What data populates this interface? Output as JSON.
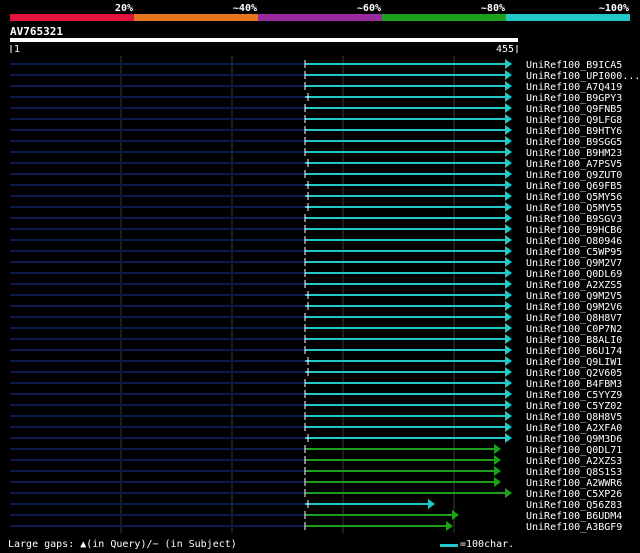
{
  "query": {
    "name": "AV765321",
    "start": "1",
    "end": "455"
  },
  "legend": {
    "labels": [
      "20%",
      "~40%",
      "~60%",
      "~80%",
      "~100%"
    ],
    "colors": [
      "#e0143c",
      "#e8761e",
      "#9a2aa0",
      "#1ea01e",
      "#20c8c8"
    ]
  },
  "colors": {
    "cyan": "#20c8c8",
    "green": "#1ea01e",
    "query_line": "#ffffff",
    "track": "#0a1a4a",
    "grid": "#3a3a3a"
  },
  "hits": [
    {
      "name": "UniRef100_B9ICA5",
      "color": "cyan"
    },
    {
      "name": "UniRef100_UPI000...",
      "color": "cyan"
    },
    {
      "name": "UniRef100_A7Q419",
      "color": "cyan"
    },
    {
      "name": "UniRef100_B9GPY3",
      "color": "cyan"
    },
    {
      "name": "UniRef100_Q9FNB5",
      "color": "cyan"
    },
    {
      "name": "UniRef100_Q9LFG8",
      "color": "cyan"
    },
    {
      "name": "UniRef100_B9HTY6",
      "color": "cyan"
    },
    {
      "name": "UniRef100_B9SGG5",
      "color": "cyan"
    },
    {
      "name": "UniRef100_B9HM23",
      "color": "cyan"
    },
    {
      "name": "UniRef100_A7PSV5",
      "color": "cyan"
    },
    {
      "name": "UniRef100_Q9ZUT0",
      "color": "cyan"
    },
    {
      "name": "UniRef100_Q69FB5",
      "color": "cyan"
    },
    {
      "name": "UniRef100_Q5MY56",
      "color": "cyan"
    },
    {
      "name": "UniRef100_Q5MY55",
      "color": "cyan"
    },
    {
      "name": "UniRef100_B9SGV3",
      "color": "cyan"
    },
    {
      "name": "UniRef100_B9HCB6",
      "color": "cyan"
    },
    {
      "name": "UniRef100_O80946",
      "color": "cyan"
    },
    {
      "name": "UniRef100_C5WP95",
      "color": "cyan"
    },
    {
      "name": "UniRef100_Q9M2V7",
      "color": "cyan"
    },
    {
      "name": "UniRef100_Q0DL69",
      "color": "cyan"
    },
    {
      "name": "UniRef100_A2XZS5",
      "color": "cyan"
    },
    {
      "name": "UniRef100_Q9M2V5",
      "color": "cyan"
    },
    {
      "name": "UniRef100_Q9M2V6",
      "color": "cyan"
    },
    {
      "name": "UniRef100_Q8H8V7",
      "color": "cyan"
    },
    {
      "name": "UniRef100_C0P7N2",
      "color": "cyan"
    },
    {
      "name": "UniRef100_B8ALI0",
      "color": "cyan"
    },
    {
      "name": "UniRef100_B6U174",
      "color": "cyan"
    },
    {
      "name": "UniRef100_Q9LIW1",
      "color": "cyan"
    },
    {
      "name": "UniRef100_Q2V605",
      "color": "cyan"
    },
    {
      "name": "UniRef100_B4FBM3",
      "color": "cyan"
    },
    {
      "name": "UniRef100_C5YYZ9",
      "color": "cyan"
    },
    {
      "name": "UniRef100_C5YZ02",
      "color": "cyan"
    },
    {
      "name": "UniRef100_Q8H8V5",
      "color": "cyan"
    },
    {
      "name": "UniRef100_A2XFA0",
      "color": "cyan"
    },
    {
      "name": "UniRef100_Q9M3D6",
      "color": "cyan"
    },
    {
      "name": "UniRef100_Q0DL71",
      "color": "green"
    },
    {
      "name": "UniRef100_A2XZS3",
      "color": "green"
    },
    {
      "name": "UniRef100_Q8S1S3",
      "color": "green"
    },
    {
      "name": "UniRef100_A2WWR6",
      "color": "green"
    },
    {
      "name": "UniRef100_C5XP26",
      "color": "green"
    },
    {
      "name": "UniRef100_Q56Z83",
      "color": "cyan"
    },
    {
      "name": "UniRef100_B6UDM4",
      "color": "green"
    },
    {
      "name": "UniRef100_A3BGF9",
      "color": "green"
    }
  ],
  "footer": {
    "gaps_text": "Large gaps: ▲(in Query)/− (in Subject)",
    "scale_text": "=100char."
  }
}
